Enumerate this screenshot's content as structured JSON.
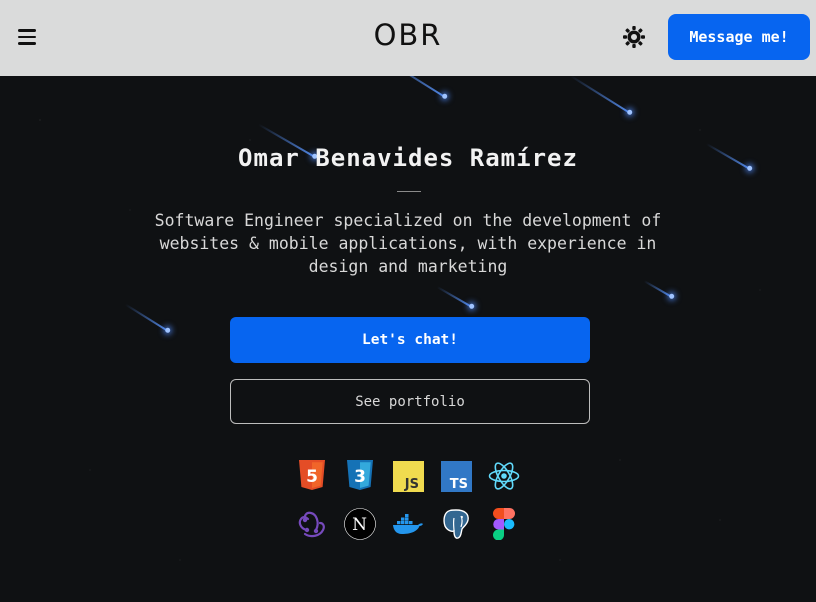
{
  "header": {
    "logo": "OBR",
    "message_button": "Message me!"
  },
  "hero": {
    "name": "Omar Benavides Ramírez",
    "tagline": "Software Engineer specialized on the development of websites & mobile applications, with experience in design and marketing",
    "chat_button": "Let's chat!",
    "portfolio_button": "See portfolio"
  },
  "tech_icons": {
    "row1": [
      {
        "name": "html5-icon",
        "text": "5",
        "color": "#e44d26"
      },
      {
        "name": "css3-icon",
        "text": "3",
        "color": "#1572b6"
      },
      {
        "name": "javascript-icon",
        "text": "JS",
        "color": "#f0db4f"
      },
      {
        "name": "typescript-icon",
        "text": "TS",
        "color": "#3178c6"
      },
      {
        "name": "react-icon",
        "color": "#61dafb"
      }
    ],
    "row2": [
      {
        "name": "redux-icon",
        "color": "#764abc"
      },
      {
        "name": "nextjs-icon",
        "text": "N",
        "color": "#000000"
      },
      {
        "name": "docker-icon",
        "color": "#2496ed"
      },
      {
        "name": "postgresql-icon",
        "color": "#336791"
      },
      {
        "name": "figma-icon",
        "color": "#a259ff"
      }
    ]
  },
  "colors": {
    "accent": "#0765f0",
    "header_bg": "#dadbdb",
    "page_bg": "#0f1113"
  }
}
